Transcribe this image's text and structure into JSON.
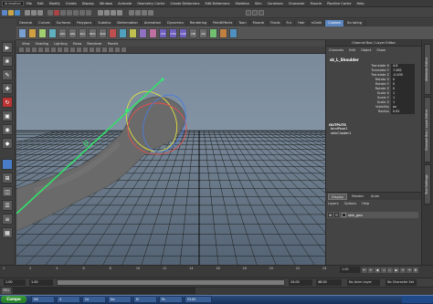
{
  "app": {
    "mode_selector": "Animation",
    "menus": [
      "File",
      "Edit",
      "Modify",
      "Create",
      "Display",
      "Window",
      "Animate",
      "Geometry Cache",
      "Create Deformers",
      "Edit Deformers",
      "Skeleton",
      "Skin",
      "Constrain",
      "Character",
      "Muscle",
      "Pipeline Cache",
      "Help"
    ]
  },
  "shelf": {
    "tabs": [
      "General",
      "Curves",
      "Surfaces",
      "Polygons",
      "Subdivs",
      "Deformation",
      "Animation",
      "Dynamics",
      "Rendering",
      "PaintEffects",
      "Toon",
      "Muscle",
      "Fluids",
      "Fur",
      "Hair",
      "nCloth",
      "Custom",
      "Scripting"
    ],
    "active_tab": "Custom",
    "buttons": [
      "",
      "",
      "",
      "",
      "LOC",
      "LRA",
      "SCL",
      "BCC",
      "SOC",
      "",
      "",
      "",
      "",
      "",
      "CM",
      "CTN",
      "CVR",
      "OB",
      "CN",
      "",
      "",
      ""
    ]
  },
  "viewport": {
    "menus": [
      "View",
      "Shading",
      "Lighting",
      "Show",
      "Renderer",
      "Panels"
    ],
    "grid_color": "#1a1a1a",
    "joint_color": "#33e06a",
    "mesh_color": "#6a6a6a"
  },
  "channel_box": {
    "title": "Channel Box / Layer Editor",
    "menus": [
      "Channels",
      "Edit",
      "Object",
      "Show"
    ],
    "object_name": "sk_L_Shoulder",
    "attributes": [
      {
        "label": "Translate X",
        "value": "4.6"
      },
      {
        "label": "Translate Y",
        "value": "7.082"
      },
      {
        "label": "Translate Z",
        "value": "-0.435"
      },
      {
        "label": "Rotate X",
        "value": "0"
      },
      {
        "label": "Rotate Y",
        "value": "0"
      },
      {
        "label": "Rotate Z",
        "value": "0"
      },
      {
        "label": "Scale X",
        "value": "1"
      },
      {
        "label": "Scale Y",
        "value": "1"
      },
      {
        "label": "Scale Z",
        "value": "1"
      },
      {
        "label": "Visibility",
        "value": "on"
      },
      {
        "label": "Radius",
        "value": "0.61"
      }
    ],
    "outputs_header": "OUTPUTS",
    "outputs": [
      "bindPose1",
      "skinCluster1"
    ]
  },
  "layer_editor": {
    "tabs": [
      "Display",
      "Render",
      "Anim"
    ],
    "active_tab": "Display",
    "menus": [
      "Layers",
      "Options",
      "Help"
    ],
    "layers": [
      {
        "v": "V",
        "p": "",
        "name": "skin_geo"
      }
    ]
  },
  "side_tabs": [
    "Attribute Editor",
    "Channel Box / Layer Editor",
    "Tool Settings"
  ],
  "time_slider": {
    "ticks": [
      "1",
      "2",
      "4",
      "6",
      "8",
      "10",
      "12",
      "14",
      "16",
      "18",
      "20",
      "22",
      "24"
    ],
    "current": "1.00"
  },
  "range_slider": {
    "start": "1.00",
    "start_inner": "1.00",
    "end_inner": "24.00",
    "end": "48.00",
    "anim_layer": "No Anim Layer",
    "character_set": "No Character Set"
  },
  "command_line": {
    "label": "MEL"
  },
  "taskbar": {
    "start": "Compo",
    "tasks": [
      "MS",
      "4",
      "Ce",
      "Do",
      "M",
      "Ps",
      "53.63"
    ],
    "clock": ""
  }
}
